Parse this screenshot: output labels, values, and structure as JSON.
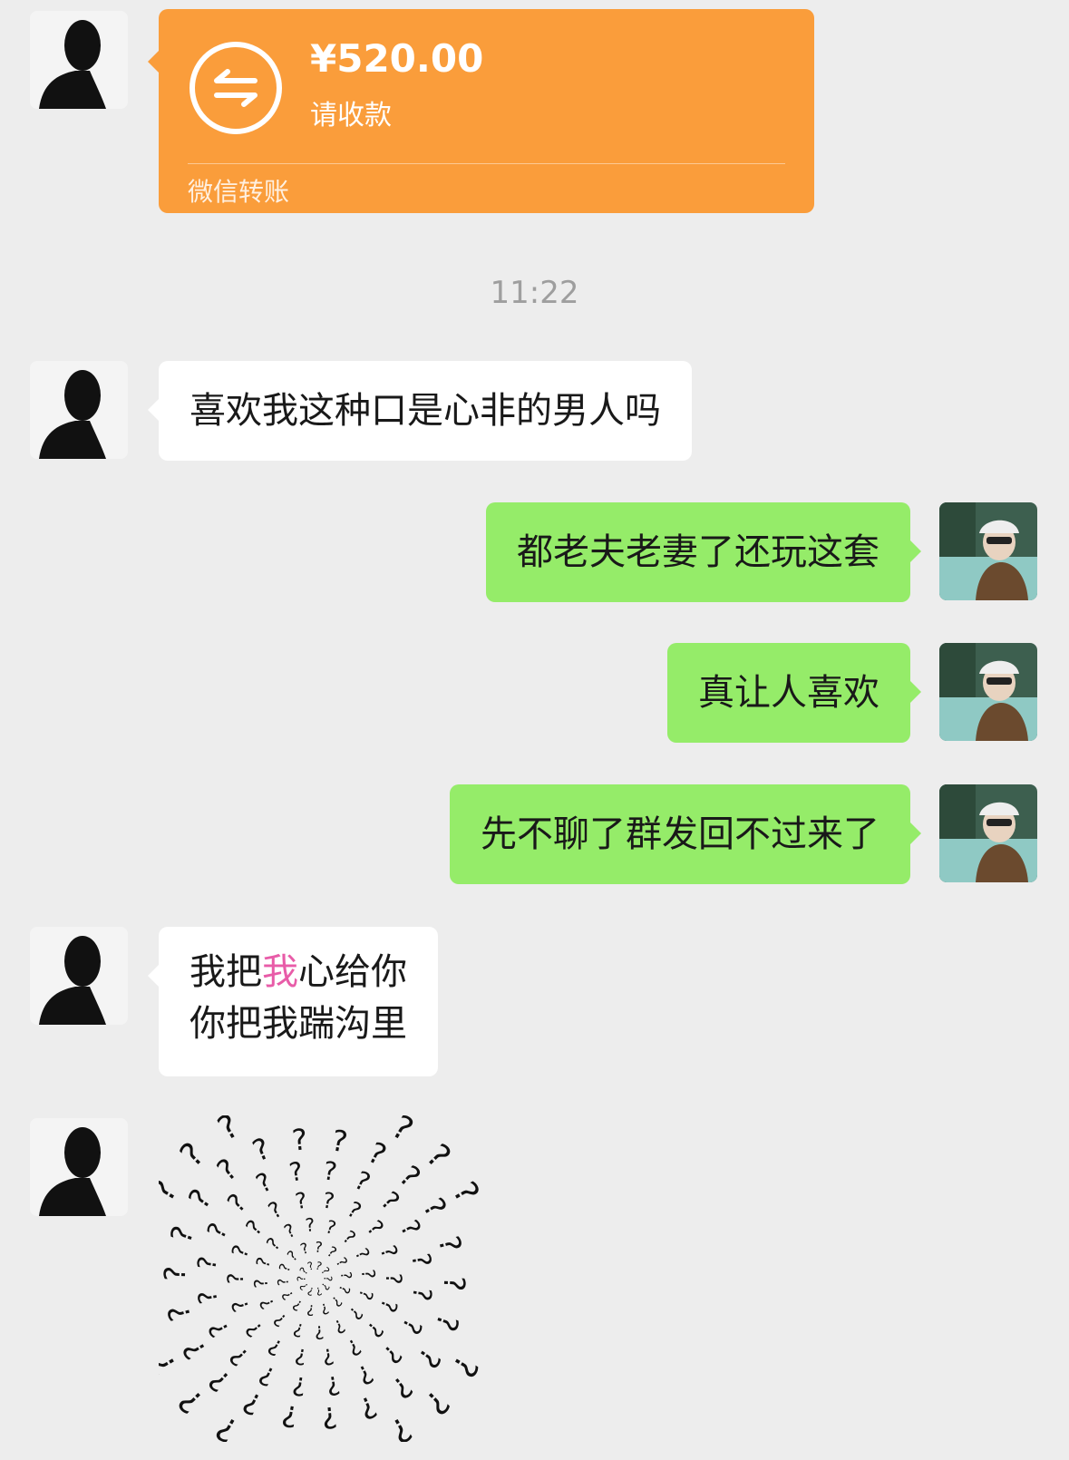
{
  "transfer": {
    "amount": "¥520.00",
    "subtitle": "请收款",
    "footer": "微信转账",
    "icon": "transfer-arrows-icon",
    "color": "#fa9d3b"
  },
  "timestamp": "11:22",
  "messages": [
    {
      "side": "left",
      "text": "喜欢我这种口是心非的男人吗"
    },
    {
      "side": "right",
      "text": "都老夫老妻了还玩这套"
    },
    {
      "side": "right",
      "text": "真让人喜欢"
    },
    {
      "side": "right",
      "text": "先不聊了群发回不过来了"
    },
    {
      "side": "left",
      "line1_a": "我把",
      "line1_highlight": "我",
      "line1_b": "心给你",
      "line2": "你把我踹沟里"
    }
  ],
  "sticker": {
    "icon": "question-mark-spiral-sticker"
  },
  "colors": {
    "background": "#ededed",
    "sent_bubble": "#95ec69",
    "received_bubble": "#ffffff",
    "highlight": "#e85ca8"
  }
}
